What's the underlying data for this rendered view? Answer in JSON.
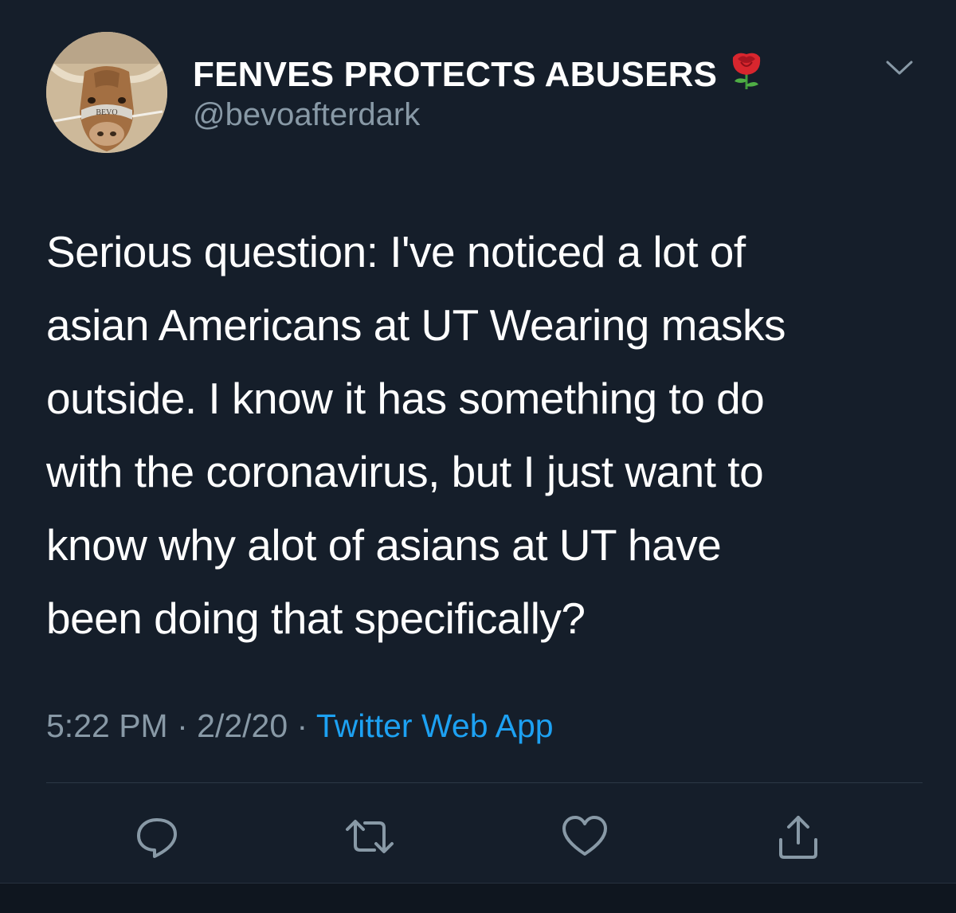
{
  "author": {
    "name": "FENVES PROTECTS ABUSERS",
    "name_emoji_icon": "rose-icon",
    "handle": "@bevoafterdark",
    "avatar_icon": "longhorn-avatar"
  },
  "tweet": {
    "text_lines": [
      "Serious question: I've noticed a lot of",
      "asian Americans at UT Wearing masks",
      "outside. I know it has something to do",
      "with the coronavirus, but I just want to",
      "know why alot of asians at UT have",
      "been doing that specifically?"
    ]
  },
  "meta": {
    "time": "5:22 PM",
    "separator": " · ",
    "date": "2/2/20",
    "source": "Twitter Web App"
  },
  "actions": {
    "reply_icon": "reply-icon",
    "retweet_icon": "retweet-icon",
    "like_icon": "heart-icon",
    "share_icon": "share-icon"
  },
  "colors": {
    "background": "#151e2a",
    "text": "#ffffff",
    "secondary": "#8899a6",
    "link": "#1da1f2"
  }
}
